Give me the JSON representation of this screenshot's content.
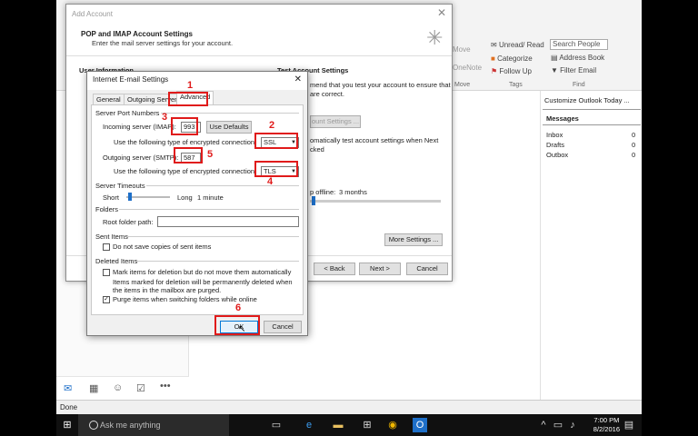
{
  "outlook": {
    "ribbon": {
      "move": "Move",
      "onenote": "OneNote",
      "move_group": "Move",
      "unread_read": "Unread/ Read",
      "categorize": "Categorize",
      "follow_up": "Follow Up",
      "tags_group": "Tags",
      "search_people": "Search People",
      "address_book": "Address Book",
      "filter_email": "Filter Email",
      "find_group": "Find"
    },
    "right_pane": {
      "customize": "Customize Outlook Today ...",
      "messages_header": "Messages",
      "rows": [
        {
          "label": "Inbox",
          "count": "0"
        },
        {
          "label": "Drafts",
          "count": "0"
        },
        {
          "label": "Outbox",
          "count": "0"
        }
      ]
    },
    "status": "Done"
  },
  "add_account": {
    "title": "Add Account",
    "heading": "POP and IMAP Account Settings",
    "subheading": "Enter the mail server settings for your account.",
    "user_info": "User Information",
    "test_header": "Test Account Settings",
    "test_text1": "mend that you test your account to ensure that",
    "test_text2": "are correct.",
    "test_btn": "ount Settings ...",
    "auto_test1": "omatically test account settings when Next",
    "auto_test2": "cked",
    "offline_label": "p offline:",
    "offline_value": "3 months",
    "more_settings": "More Settings ...",
    "back": "< Back",
    "next": "Next >",
    "cancel": "Cancel"
  },
  "dialog": {
    "title": "Internet E-mail Settings",
    "tabs": [
      "General",
      "Outgoing Server",
      "Advanced"
    ],
    "server_port_numbers": "Server Port Numbers",
    "incoming_label": "Incoming server (IMAP):",
    "incoming_value": "993",
    "use_defaults": "Use Defaults",
    "enc_label": "Use the following type of encrypted connection:",
    "incoming_enc": "SSL",
    "outgoing_label": "Outgoing server (SMTP):",
    "outgoing_value": "587",
    "outgoing_enc": "TLS",
    "server_timeouts": "Server Timeouts",
    "short": "Short",
    "long": "Long",
    "timeout_value": "1 minute",
    "folders": "Folders",
    "root_folder": "Root folder path:",
    "sent_items": "Sent Items",
    "dont_save": "Do not save copies of sent items",
    "deleted_items": "Deleted Items",
    "mark_items": "Mark items for deletion but do not move them automatically",
    "mark_note1": "Items marked for deletion will be permanently deleted when",
    "mark_note2": "the items in the mailbox are purged.",
    "purge_items": "Purge items when switching folders while online",
    "ok": "OK",
    "cancel": "Cancel"
  },
  "annotations": [
    "1",
    "2",
    "3",
    "4",
    "5",
    "6"
  ],
  "taskbar": {
    "search": "Ask me anything",
    "time": "7:00 PM",
    "date": "8/2/2016"
  },
  "colors": {
    "annotation": "#e01a1a",
    "outlook_blue": "#1e6fc8"
  }
}
